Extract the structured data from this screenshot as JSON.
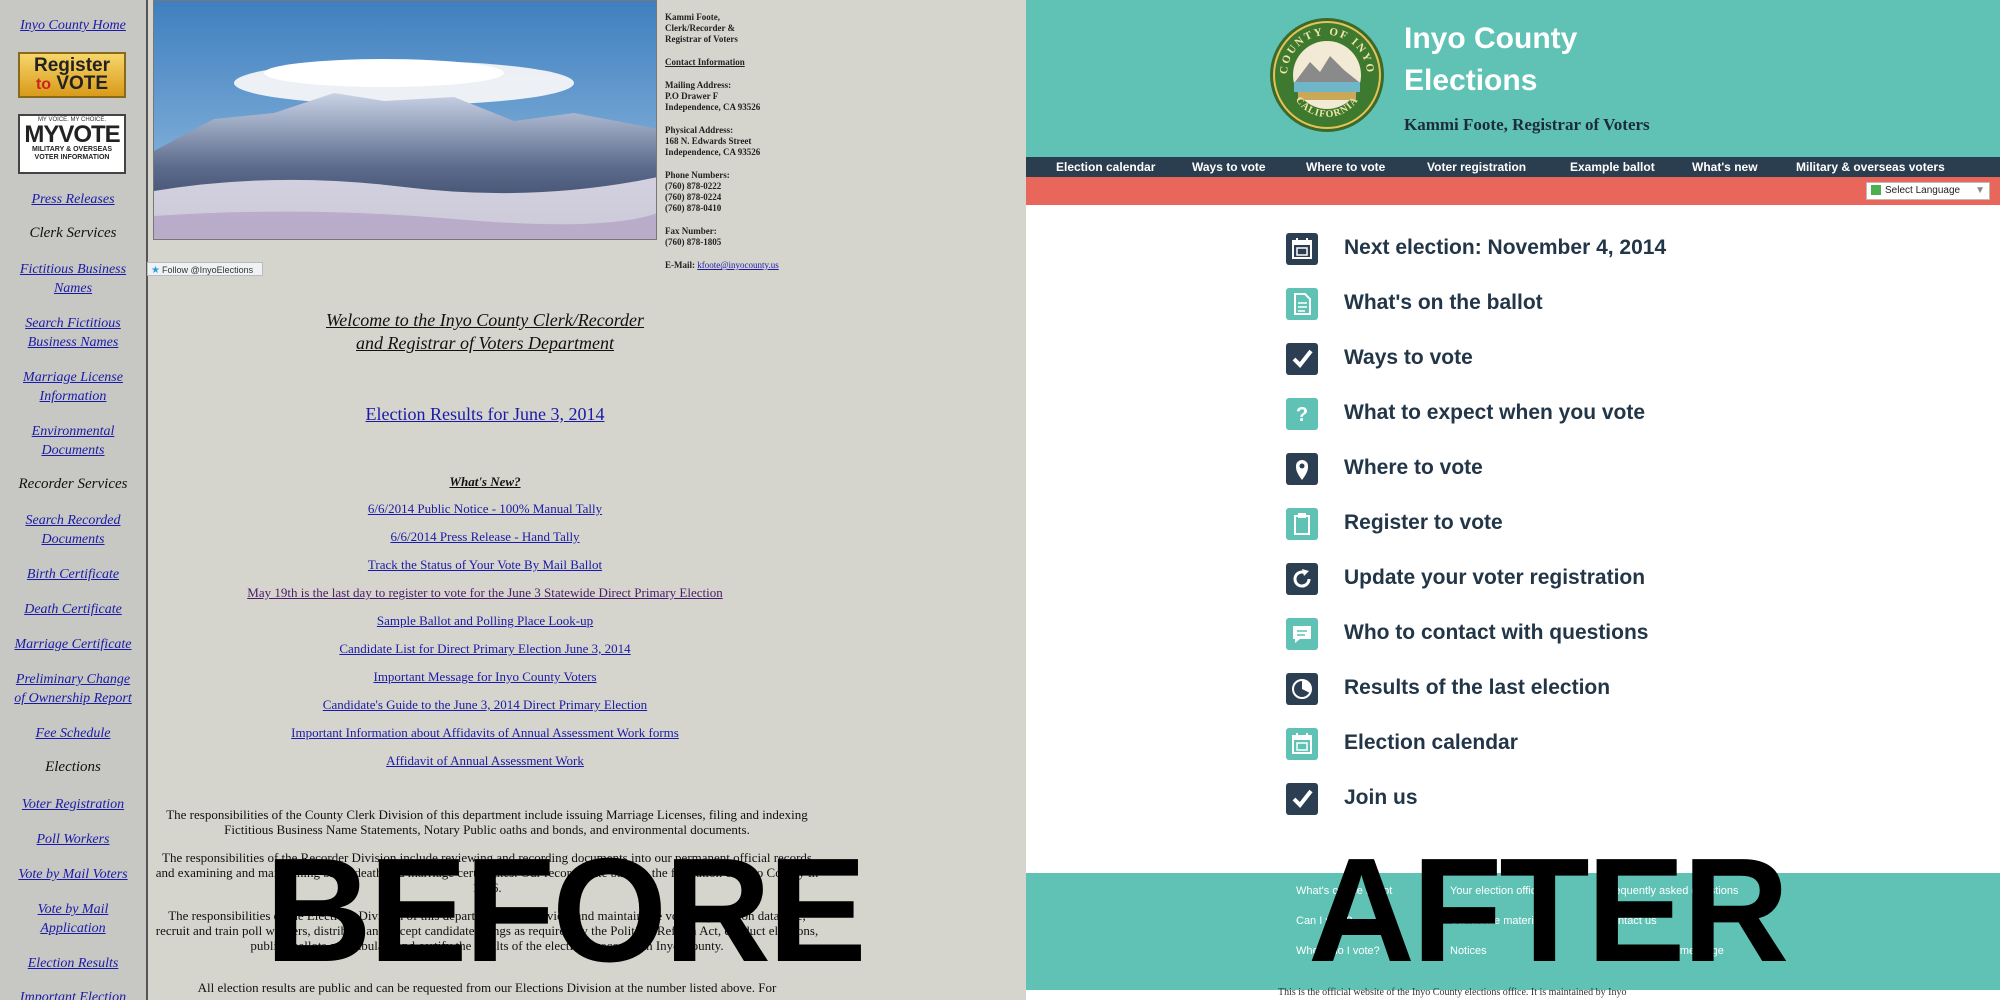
{
  "before": {
    "sidebar": {
      "home": "Inyo County Home",
      "register_line1": "Register",
      "register_to": "to",
      "register_line2": "VOTE",
      "myvote_tag": "MY VOICE. MY CHOICE.",
      "myvote_big": "MYVOTE",
      "myvote_sub1": "MILITARY & OVERSEAS",
      "myvote_sub2": "VOTER INFORMATION",
      "press": "Press Releases",
      "clerk_head": "Clerk Services",
      "fictitious1": "Fictitious Business",
      "fictitious2": "Names",
      "search_fict1": "Search Fictitious",
      "search_fict2": "Business Names",
      "marriage_lic1": "Marriage License",
      "marriage_lic2": "Information",
      "env1": "Environmental",
      "env2": "Documents",
      "recorder_head": "Recorder Services",
      "search_rec1": "Search Recorded",
      "search_rec2": "Documents",
      "birth": "Birth Certificate",
      "death": "Death Certificate",
      "marriage_cert": "Marriage Certificate",
      "prelim1": "Preliminary Change",
      "prelim2": "of Ownership Report",
      "fee": "Fee Schedule",
      "elections_head": "Elections",
      "voter_reg": "Voter Registration",
      "poll": "Poll Workers",
      "vbm": "Vote by Mail Voters",
      "vbm_app1": "Vote by Mail",
      "vbm_app2": "Application",
      "election_results": "Election Results",
      "important": "Important Election"
    },
    "contact": {
      "name1": "Kammi Foote,",
      "name2": "Clerk/Recorder &",
      "name3": "Registrar of Voters",
      "heading": "Contact Information",
      "mail_h": "Mailing Address:",
      "mail1": "P.O Drawer F",
      "mail2": "Independence, CA 93526",
      "phys_h": "Physical Address:",
      "phys1": "168 N. Edwards Street",
      "phys2": "Independence, CA 93526",
      "phone_h": "Phone Numbers:",
      "phone1": "(760) 878-0222",
      "phone2": "(760) 878-0224",
      "phone3": "(760) 878-0410",
      "fax_h": "Fax Number:",
      "fax": "(760) 878-1805",
      "email_label": "E-Mail:",
      "email": "kfoote@inyocounty.us"
    },
    "follow": "Follow @InyoElections",
    "welcome1": "Welcome to the Inyo County Clerk/Recorder",
    "welcome2": "and Registrar of Voters Department",
    "results_link": "Election Results for June 3, 2014",
    "whats_new": "What's New?",
    "news": [
      "6/6/2014 Public Notice - 100% Manual Tally",
      "6/6/2014 Press Release - Hand Tally",
      "Track the Status of Your Vote By Mail Ballot",
      "May 19th is the last day to register to vote for the June 3 Statewide Direct Primary Election",
      "Sample Ballot and Polling Place Look-up",
      "Candidate List for Direct Primary Election June 3, 2014",
      "Important Message for Inyo County Voters",
      "Candidate's Guide to the June 3, 2014 Direct Primary Election",
      "Important Information about Affidavits of Annual Assessment Work forms",
      "Affidavit of Annual Assessment Work"
    ],
    "para1": "The responsibilities of the County Clerk Division of this department include issuing Marriage Licenses, filing and indexing Fictitious Business Name Statements, Notary Public oaths and bonds, and environmental documents.",
    "para2": "The responsibilities of the Recorder Division include reviewing and recording documents into our permanent official records and examining and maintaining birth, death and marriage certificates. Our records date back to the formation of Inyo County in 1866.",
    "para3": "The responsibilities of the Elections Division of this department are to review and maintain the voter registration database, recruit and train poll workers, distribute and accept candidate filings as required by the Political Reform Act, conduct elections, publish ballots and tabulate and certify the results of the election processes in Inyo County.",
    "para4": "All election results are public and can be requested from our Elections Division at the number listed above. For",
    "overlay": "BEFORE"
  },
  "after": {
    "title1": "Inyo County",
    "title2": "Elections",
    "subtitle": "Kammi Foote, Registrar of Voters",
    "seal_top": "COUNTY OF INYO",
    "seal_bottom": "CALIFORNIA",
    "nav": [
      "Election calendar",
      "Ways to vote",
      "Where to vote",
      "Voter registration",
      "Example ballot",
      "What's new",
      "Military & overseas voters"
    ],
    "language": "Select Language",
    "items": [
      {
        "label": "Next election: November 4, 2014",
        "icon": "calendar-icon"
      },
      {
        "label": "What's on the ballot",
        "icon": "document-icon"
      },
      {
        "label": "Ways to vote",
        "icon": "checkbox-icon"
      },
      {
        "label": "What to expect when you vote",
        "icon": "question-icon"
      },
      {
        "label": "Where to vote",
        "icon": "map-pin-icon"
      },
      {
        "label": "Register to vote",
        "icon": "clipboard-icon"
      },
      {
        "label": "Update your voter registration",
        "icon": "refresh-icon"
      },
      {
        "label": "Who to contact with questions",
        "icon": "chat-icon"
      },
      {
        "label": "Results of the last election",
        "icon": "pie-chart-icon"
      },
      {
        "label": "Election calendar",
        "icon": "calendar-icon"
      },
      {
        "label": "Join us",
        "icon": "checkbox-icon"
      }
    ],
    "footer": {
      "c1": [
        "What's on the ballot",
        "Can I vote?",
        "Where do I vote?"
      ],
      "c2": [
        "Your election officials",
        "Candidate materials",
        "Notices"
      ],
      "c3": [
        "Frequently asked questions",
        "Contact us",
        "Inyo County Home Page"
      ],
      "bottom": "This is the official website of the Inyo County elections office. It is maintained by Inyo"
    },
    "overlay": "AFTER"
  },
  "colors": {
    "teal": "#5fc2b5",
    "navy": "#2b3e4f",
    "coral": "#e8665a",
    "link_blue": "#1a1aa8"
  }
}
